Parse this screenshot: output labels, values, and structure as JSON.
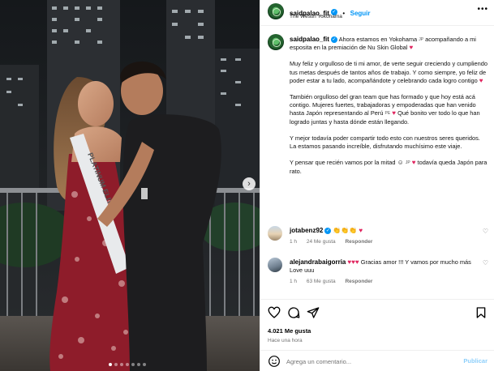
{
  "post": {
    "username": "saidpalao_fit",
    "follow_label": "Seguir",
    "location": "The Westin Yokohama",
    "more_icon": "more-icon",
    "caption": {
      "p1_a": "Ahora estamos en Yokohama",
      "p1_flag": "JP",
      "p1_b": "acompañando a mi esposita en la premiación de Nu Skin Global",
      "p2": "Muy feliz y orgulloso de ti mi amor, de verte seguir creciendo y cumpliendo tus metas después de tantos años de trabajo. Y como siempre, yo feliz de poder estar a tu lado, acompañándote y celebrando cada logro contigo",
      "p3_a": "También orgulloso del gran team que has formado y que hoy está acá contigo. Mujeres fuertes, trabajadoras y empoderadas que han venido hasta Japón representando al Perú",
      "p3_flag": "PE",
      "p3_b": "Qué bonito ver todo lo que han logrado juntas y hasta dónde están llegando.",
      "p4": "Y mejor todavía poder compartir todo esto con nuestros seres queridos. La estamos pasando increíble, disfrutando muchísimo este viaje.",
      "p5_a": "Y pensar que recién vamos por la mitad",
      "p5_flag": "JP",
      "p5_b": "todavía queda Japón para rato."
    },
    "image_sash_text": "PLATINUM ELITE",
    "image_sash_logo": "NS"
  },
  "comments": [
    {
      "username": "jotabenz92",
      "text": "",
      "age": "1 h",
      "likes": "24 Me gusta",
      "reply": "Responder"
    },
    {
      "username": "alejandrabaigorria",
      "text": "Gracias amor !!! Y vamos por mucho más Love uuu",
      "age": "1 h",
      "likes": "63 Me gusta",
      "reply": "Responder"
    }
  ],
  "actions": {
    "likes_count": "4.021 Me gusta",
    "posted": "Hace una hora"
  },
  "comment_box": {
    "placeholder": "Agrega un comentario...",
    "publish_label": "Publicar"
  },
  "colors": {
    "accent": "#0095f6",
    "heart": "#e0245e",
    "muted": "#737373"
  }
}
